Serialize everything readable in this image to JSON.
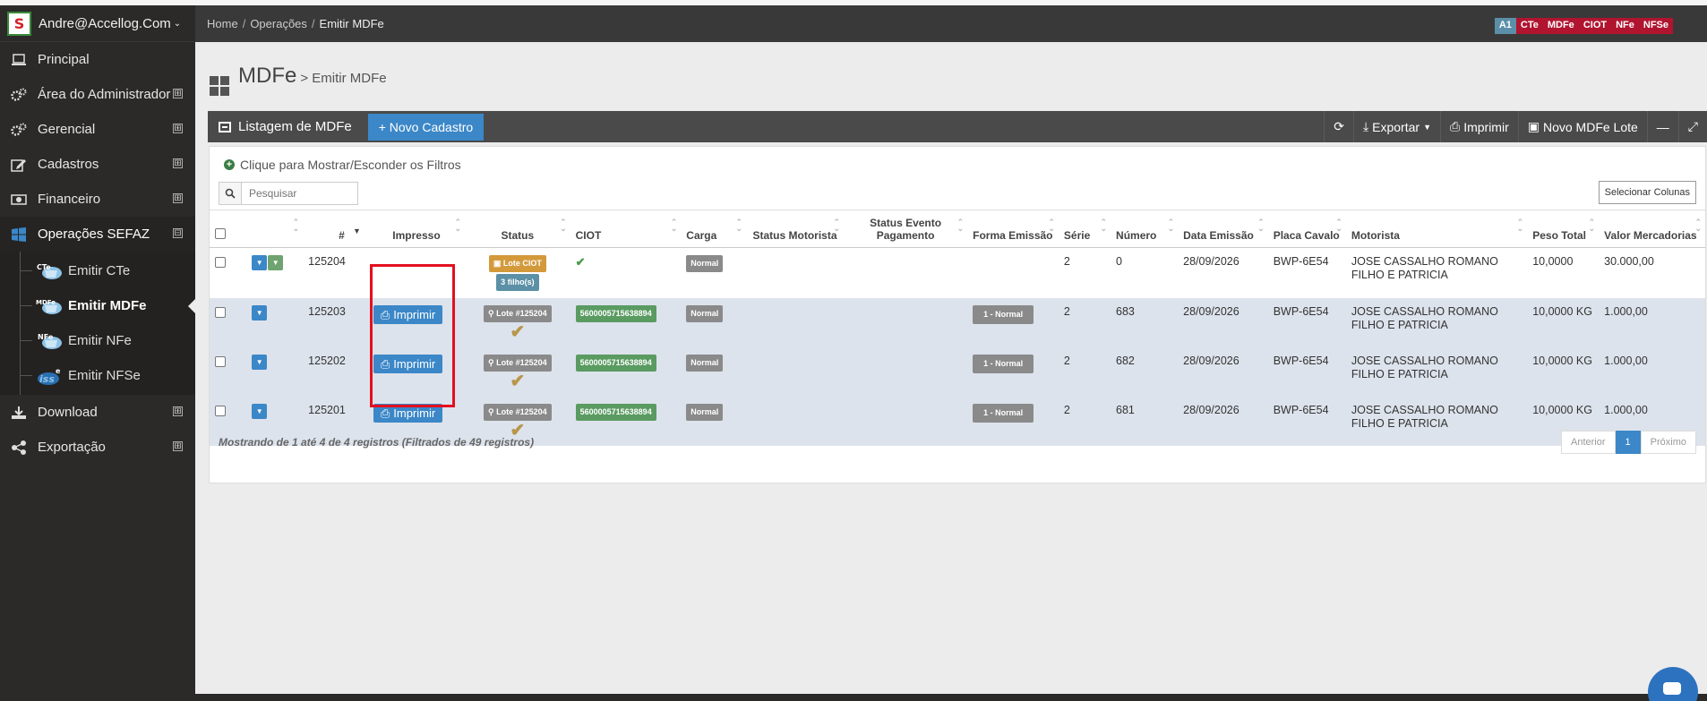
{
  "sidebar": {
    "user": "Andre@Accellog.Com",
    "logo_letter": "S",
    "items": [
      {
        "label": "Principal",
        "icon": "laptop-icon",
        "expandable": false
      },
      {
        "label": "Área do Administrador",
        "icon": "gears-icon",
        "expandable": true
      },
      {
        "label": "Gerencial",
        "icon": "gears-icon",
        "expandable": true
      },
      {
        "label": "Cadastros",
        "icon": "edit-icon",
        "expandable": true
      },
      {
        "label": "Financeiro",
        "icon": "money-icon",
        "expandable": true
      },
      {
        "label": "Operações SEFAZ",
        "icon": "windows-icon",
        "expandable": true,
        "expanded": true
      },
      {
        "label": "Download",
        "icon": "download-icon",
        "expandable": true
      },
      {
        "label": "Exportação",
        "icon": "share-icon",
        "expandable": true
      }
    ],
    "subitems": [
      {
        "label": "Emitir CTe",
        "icon": "cte-icon",
        "badge": "CTe"
      },
      {
        "label": "Emitir MDFe",
        "icon": "mdfe-icon",
        "badge": "MDFe"
      },
      {
        "label": "Emitir NFe",
        "icon": "nfe-icon",
        "badge": "NFe"
      },
      {
        "label": "Emitir NFSe",
        "icon": "nfse-icon",
        "badge": "NFSe"
      }
    ],
    "expand_glyph": "⊞",
    "collapse_glyph": "⊟"
  },
  "header": {
    "breadcrumb": [
      "Home",
      "Operações",
      "Emitir MDFe"
    ],
    "badges": [
      "A1",
      "CTe",
      "MDFe",
      "CIOT",
      "NFe",
      "NFSe"
    ]
  },
  "page": {
    "title": "MDFe",
    "subtitle": "> Emitir MDFe"
  },
  "toolbar": {
    "title": "Listagem de MDFe",
    "new_button": "+ Novo Cadastro",
    "export": "Exportar",
    "print": "Imprimir",
    "new_batch": "Novo MDFe Lote"
  },
  "filters": {
    "toggle_label": "Clique para Mostrar/Esconder os Filtros",
    "search_placeholder": "Pesquisar",
    "select_columns": "Selecionar Colunas"
  },
  "table": {
    "headers": [
      "#",
      "Impresso",
      "Status",
      "CIOT",
      "Carga",
      "Status Motorista",
      "Status Evento Pagamento",
      "Forma Emissão",
      "Série",
      "Número",
      "Data Emissão",
      "Placa Cavalo",
      "Motorista",
      "Peso Total",
      "Valor Mercadorias"
    ],
    "rows": [
      {
        "id": "125204",
        "print_label": "",
        "status_labels": [
          "Lote CIOT",
          "3 filho(s)"
        ],
        "ciot": "",
        "ciot_check": true,
        "carga": "Normal",
        "status_motorista": "",
        "status_evento": "",
        "forma_emissao": "",
        "serie": "2",
        "numero": "0",
        "data": "28/09/2026",
        "placa": "BWP-6E54",
        "motorista": "JOSE CASSALHO ROMANO FILHO E PATRICIA",
        "peso": "10,0000",
        "valor": "30.000,00"
      },
      {
        "id": "125203",
        "print_label": "Imprimir",
        "status_labels": [
          "Lote #125204"
        ],
        "ciot": "5600005715638894",
        "carga": "Normal",
        "status_motorista": "",
        "status_evento": "",
        "forma_emissao": "1 - Normal",
        "serie": "2",
        "numero": "683",
        "data": "28/09/2026",
        "placa": "BWP-6E54",
        "motorista": "JOSE CASSALHO ROMANO FILHO E PATRICIA",
        "peso": "10,0000 KG",
        "valor": "1.000,00"
      },
      {
        "id": "125202",
        "print_label": "Imprimir",
        "status_labels": [
          "Lote #125204"
        ],
        "ciot": "5600005715638894",
        "carga": "Normal",
        "status_motorista": "",
        "status_evento": "",
        "forma_emissao": "1 - Normal",
        "serie": "2",
        "numero": "682",
        "data": "28/09/2026",
        "placa": "BWP-6E54",
        "motorista": "JOSE CASSALHO ROMANO FILHO E PATRICIA",
        "peso": "10,0000 KG",
        "valor": "1.000,00"
      },
      {
        "id": "125201",
        "print_label": "Imprimir",
        "status_labels": [
          "Lote #125204"
        ],
        "ciot": "5600005715638894",
        "carga": "Normal",
        "status_motorista": "",
        "status_evento": "",
        "forma_emissao": "1 - Normal",
        "serie": "2",
        "numero": "681",
        "data": "28/09/2026",
        "placa": "BWP-6E54",
        "motorista": "JOSE CASSALHO ROMANO FILHO E PATRICIA",
        "peso": "10,0000 KG",
        "valor": "1.000,00"
      }
    ]
  },
  "footer": {
    "info": "Mostrando de 1 até 4 de 4 registros (Filtrados de 49 registros)",
    "prev": "Anterior",
    "page": "1",
    "next": "Próximo"
  },
  "colors": {
    "accent": "#3b87c8",
    "sidebar_bg": "#2b2a29",
    "highlight": "#e3101f",
    "badge_red": "#b0142f"
  }
}
